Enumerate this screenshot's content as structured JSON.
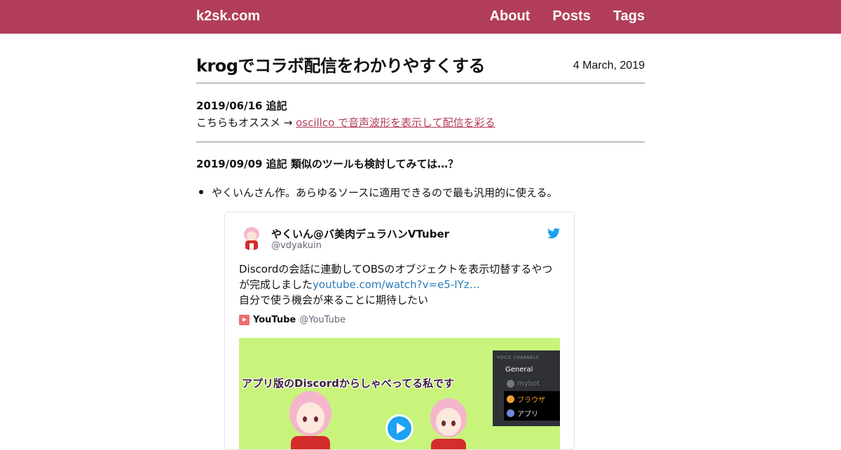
{
  "site": {
    "brand": "k2sk.com",
    "accent": "#b23d5a"
  },
  "nav": {
    "items": [
      "About",
      "Posts",
      "Tags"
    ]
  },
  "post": {
    "title": "krogでコラボ配信をわかりやすくする",
    "date": "4 March, 2019"
  },
  "note1": {
    "heading": "2019/06/16 追記",
    "prefix": "こちらもオススメ → ",
    "link_text": "oscillco で音声波形を表示して配信を彩る"
  },
  "note2": {
    "heading": "2019/09/09 追記 類似のツールも検討してみては…？",
    "bullet": "やくいんさん作。あらゆるソースに適用できるので最も汎用的に使える。"
  },
  "tweet": {
    "name": "やくいん@バ美肉デュラハンVTuber",
    "handle": "@vdyakuin",
    "text_line1": "Discordの会話に連動してOBSのオブジェクトを表示切替するやつ　が完成しました",
    "link": "youtube.com/watch?v=e5-IYz…",
    "text_line2": "自分で使う機会が来ることに期待したい",
    "quote_name": "YouTube",
    "quote_handle": "@YouTube",
    "media": {
      "caption": "アプリ版のDiscordからしゃべってる私です",
      "panel_header": "VOICE CHANNELS",
      "channel": "General",
      "users": [
        "mybot",
        "ブラウザ",
        "アプリ"
      ]
    }
  }
}
